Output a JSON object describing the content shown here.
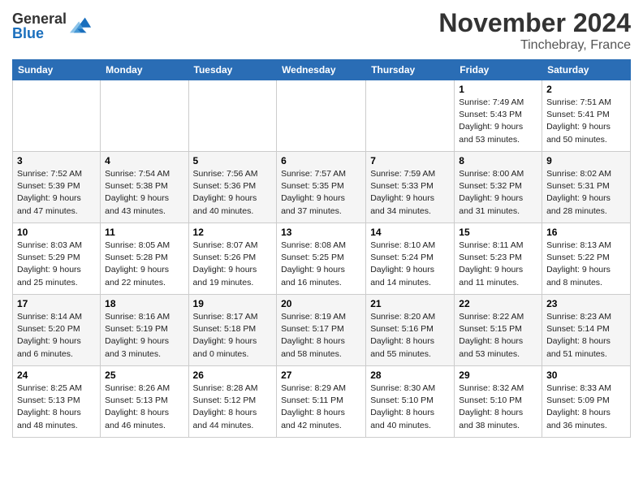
{
  "logo": {
    "general": "General",
    "blue": "Blue"
  },
  "title": "November 2024",
  "location": "Tinchebray, France",
  "days_of_week": [
    "Sunday",
    "Monday",
    "Tuesday",
    "Wednesday",
    "Thursday",
    "Friday",
    "Saturday"
  ],
  "weeks": [
    [
      {
        "day": "",
        "info": ""
      },
      {
        "day": "",
        "info": ""
      },
      {
        "day": "",
        "info": ""
      },
      {
        "day": "",
        "info": ""
      },
      {
        "day": "",
        "info": ""
      },
      {
        "day": "1",
        "info": "Sunrise: 7:49 AM\nSunset: 5:43 PM\nDaylight: 9 hours and 53 minutes."
      },
      {
        "day": "2",
        "info": "Sunrise: 7:51 AM\nSunset: 5:41 PM\nDaylight: 9 hours and 50 minutes."
      }
    ],
    [
      {
        "day": "3",
        "info": "Sunrise: 7:52 AM\nSunset: 5:39 PM\nDaylight: 9 hours and 47 minutes."
      },
      {
        "day": "4",
        "info": "Sunrise: 7:54 AM\nSunset: 5:38 PM\nDaylight: 9 hours and 43 minutes."
      },
      {
        "day": "5",
        "info": "Sunrise: 7:56 AM\nSunset: 5:36 PM\nDaylight: 9 hours and 40 minutes."
      },
      {
        "day": "6",
        "info": "Sunrise: 7:57 AM\nSunset: 5:35 PM\nDaylight: 9 hours and 37 minutes."
      },
      {
        "day": "7",
        "info": "Sunrise: 7:59 AM\nSunset: 5:33 PM\nDaylight: 9 hours and 34 minutes."
      },
      {
        "day": "8",
        "info": "Sunrise: 8:00 AM\nSunset: 5:32 PM\nDaylight: 9 hours and 31 minutes."
      },
      {
        "day": "9",
        "info": "Sunrise: 8:02 AM\nSunset: 5:31 PM\nDaylight: 9 hours and 28 minutes."
      }
    ],
    [
      {
        "day": "10",
        "info": "Sunrise: 8:03 AM\nSunset: 5:29 PM\nDaylight: 9 hours and 25 minutes."
      },
      {
        "day": "11",
        "info": "Sunrise: 8:05 AM\nSunset: 5:28 PM\nDaylight: 9 hours and 22 minutes."
      },
      {
        "day": "12",
        "info": "Sunrise: 8:07 AM\nSunset: 5:26 PM\nDaylight: 9 hours and 19 minutes."
      },
      {
        "day": "13",
        "info": "Sunrise: 8:08 AM\nSunset: 5:25 PM\nDaylight: 9 hours and 16 minutes."
      },
      {
        "day": "14",
        "info": "Sunrise: 8:10 AM\nSunset: 5:24 PM\nDaylight: 9 hours and 14 minutes."
      },
      {
        "day": "15",
        "info": "Sunrise: 8:11 AM\nSunset: 5:23 PM\nDaylight: 9 hours and 11 minutes."
      },
      {
        "day": "16",
        "info": "Sunrise: 8:13 AM\nSunset: 5:22 PM\nDaylight: 9 hours and 8 minutes."
      }
    ],
    [
      {
        "day": "17",
        "info": "Sunrise: 8:14 AM\nSunset: 5:20 PM\nDaylight: 9 hours and 6 minutes."
      },
      {
        "day": "18",
        "info": "Sunrise: 8:16 AM\nSunset: 5:19 PM\nDaylight: 9 hours and 3 minutes."
      },
      {
        "day": "19",
        "info": "Sunrise: 8:17 AM\nSunset: 5:18 PM\nDaylight: 9 hours and 0 minutes."
      },
      {
        "day": "20",
        "info": "Sunrise: 8:19 AM\nSunset: 5:17 PM\nDaylight: 8 hours and 58 minutes."
      },
      {
        "day": "21",
        "info": "Sunrise: 8:20 AM\nSunset: 5:16 PM\nDaylight: 8 hours and 55 minutes."
      },
      {
        "day": "22",
        "info": "Sunrise: 8:22 AM\nSunset: 5:15 PM\nDaylight: 8 hours and 53 minutes."
      },
      {
        "day": "23",
        "info": "Sunrise: 8:23 AM\nSunset: 5:14 PM\nDaylight: 8 hours and 51 minutes."
      }
    ],
    [
      {
        "day": "24",
        "info": "Sunrise: 8:25 AM\nSunset: 5:13 PM\nDaylight: 8 hours and 48 minutes."
      },
      {
        "day": "25",
        "info": "Sunrise: 8:26 AM\nSunset: 5:13 PM\nDaylight: 8 hours and 46 minutes."
      },
      {
        "day": "26",
        "info": "Sunrise: 8:28 AM\nSunset: 5:12 PM\nDaylight: 8 hours and 44 minutes."
      },
      {
        "day": "27",
        "info": "Sunrise: 8:29 AM\nSunset: 5:11 PM\nDaylight: 8 hours and 42 minutes."
      },
      {
        "day": "28",
        "info": "Sunrise: 8:30 AM\nSunset: 5:10 PM\nDaylight: 8 hours and 40 minutes."
      },
      {
        "day": "29",
        "info": "Sunrise: 8:32 AM\nSunset: 5:10 PM\nDaylight: 8 hours and 38 minutes."
      },
      {
        "day": "30",
        "info": "Sunrise: 8:33 AM\nSunset: 5:09 PM\nDaylight: 8 hours and 36 minutes."
      }
    ]
  ]
}
